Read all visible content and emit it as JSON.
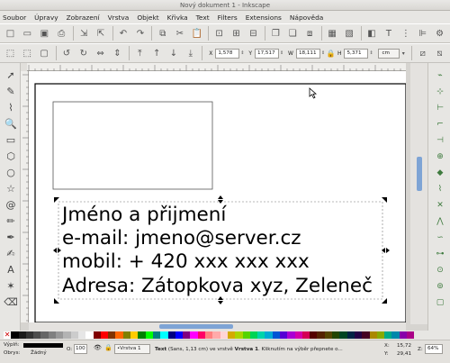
{
  "window": {
    "title": "Nový dokument 1 - Inkscape"
  },
  "menu": [
    "Soubor",
    "Úpravy",
    "Zobrazení",
    "Vrstva",
    "Objekt",
    "Křivka",
    "Text",
    "Filters",
    "Extensions",
    "Nápověda"
  ],
  "toolbar": {
    "x_label": "X",
    "x_value": "1,578",
    "y_label": "Y",
    "y_value": "17,517",
    "w_label": "W",
    "w_value": "18,111",
    "h_label": "H",
    "h_value": "5,371",
    "unit": "cm"
  },
  "canvas": {
    "text_lines": [
      "Jméno a přijmení",
      "e-mail: jmeno@server.cz",
      "mobil: + 420 xxx xxx xxx",
      "Adresa: Zátopkova xyz, Zeleneč"
    ]
  },
  "palette": {
    "colors": [
      "#000000",
      "#1a1a1a",
      "#333333",
      "#4d4d4d",
      "#666666",
      "#808080",
      "#999999",
      "#b3b3b3",
      "#cccccc",
      "#e6e6e6",
      "#ffffff",
      "#800000",
      "#ff0000",
      "#803300",
      "#ff6600",
      "#808000",
      "#ffcc00",
      "#008000",
      "#00ff00",
      "#008080",
      "#00ffff",
      "#000080",
      "#0000ff",
      "#800080",
      "#ff00ff",
      "#ff0066",
      "#ff8080",
      "#ffaaaa",
      "#ffd5d5",
      "#d4aa00",
      "#aad400",
      "#55d400",
      "#00d455",
      "#00d4aa",
      "#00aad4",
      "#0055d4",
      "#5500d4",
      "#aa00d4",
      "#d400aa",
      "#d40055",
      "#550000",
      "#552200",
      "#554400",
      "#224400",
      "#004422",
      "#002244",
      "#220044",
      "#440022",
      "#aa8800",
      "#88aa00",
      "#00aa88",
      "#0088aa",
      "#8800aa",
      "#aa0088"
    ]
  },
  "status": {
    "fill_label": "Výplň:",
    "stroke_label": "Obrys:",
    "stroke_value": "Žádný",
    "opacity_label": "O:",
    "opacity_value": "100",
    "layer_value": "•Vrstva 1",
    "message_bold": "Text",
    "message_mid": " (Sans, 1,13 cm) ve vrstvě ",
    "message_layer": "Vrstva 1",
    "message_rest": ". Kliknutím na výběr přepnete o...",
    "x_label": "X:",
    "x_value": "15,72",
    "y_label": "Y:",
    "y_value": "29,41",
    "z_label": "Z:",
    "zoom_value": "64%"
  }
}
